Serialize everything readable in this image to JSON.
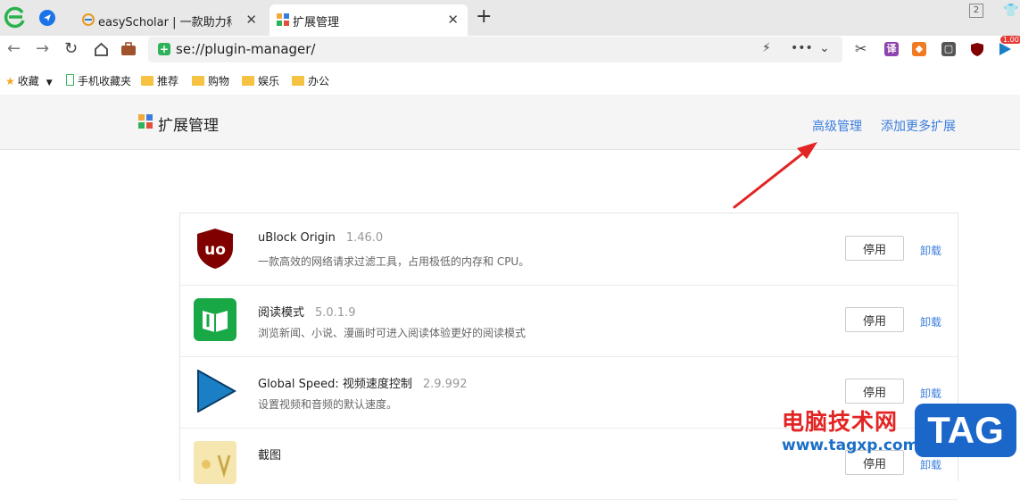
{
  "tabs": [
    {
      "title": "easyScholar | 一款助力科研的",
      "active": false
    },
    {
      "title": "扩展管理",
      "active": true
    }
  ],
  "window": {
    "tab_count": "2"
  },
  "address_bar": {
    "url": "se://plugin-manager/"
  },
  "toolbar_extensions": [
    {
      "icon": "scissors-icon"
    },
    {
      "icon": "translate-icon",
      "label": "译"
    },
    {
      "icon": "game-icon"
    },
    {
      "icon": "reader-icon"
    },
    {
      "icon": "ublock-icon"
    },
    {
      "icon": "speed-icon",
      "badge": "1.00"
    }
  ],
  "bookmarks": {
    "favorites": "收藏",
    "items": [
      "手机收藏夹",
      "推荐",
      "购物",
      "娱乐",
      "办公"
    ]
  },
  "page": {
    "title": "扩展管理",
    "links": {
      "advanced": "高级管理",
      "add_more": "添加更多扩展"
    }
  },
  "extensions": [
    {
      "name": "uBlock Origin",
      "version": "1.46.0",
      "description": "一款高效的网络请求过滤工具，占用极低的内存和 CPU。",
      "icon": "ublock-origin-icon",
      "disable_label": "停用",
      "uninstall_label": "卸载"
    },
    {
      "name": "阅读模式",
      "version": "5.0.1.9",
      "description": "浏览新闻、小说、漫画时可进入阅读体验更好的阅读模式",
      "icon": "reading-mode-icon",
      "disable_label": "停用",
      "uninstall_label": "卸载"
    },
    {
      "name": "Global Speed: 视频速度控制",
      "version": "2.9.992",
      "description": "设置视频和音频的默认速度。",
      "icon": "play-triangle-icon",
      "disable_label": "停用",
      "uninstall_label": "卸载"
    },
    {
      "name": "截图",
      "version": "",
      "description": "",
      "icon": "screenshot-icon",
      "disable_label": "停用",
      "uninstall_label": "卸载"
    }
  ],
  "watermark": {
    "site_name": "电脑技术网",
    "url": "www.tagxp.com",
    "logo": "TAG"
  },
  "colors": {
    "link": "#3b7ddd",
    "arrow": "#e32424",
    "watermark_blue": "#1a67c9"
  }
}
